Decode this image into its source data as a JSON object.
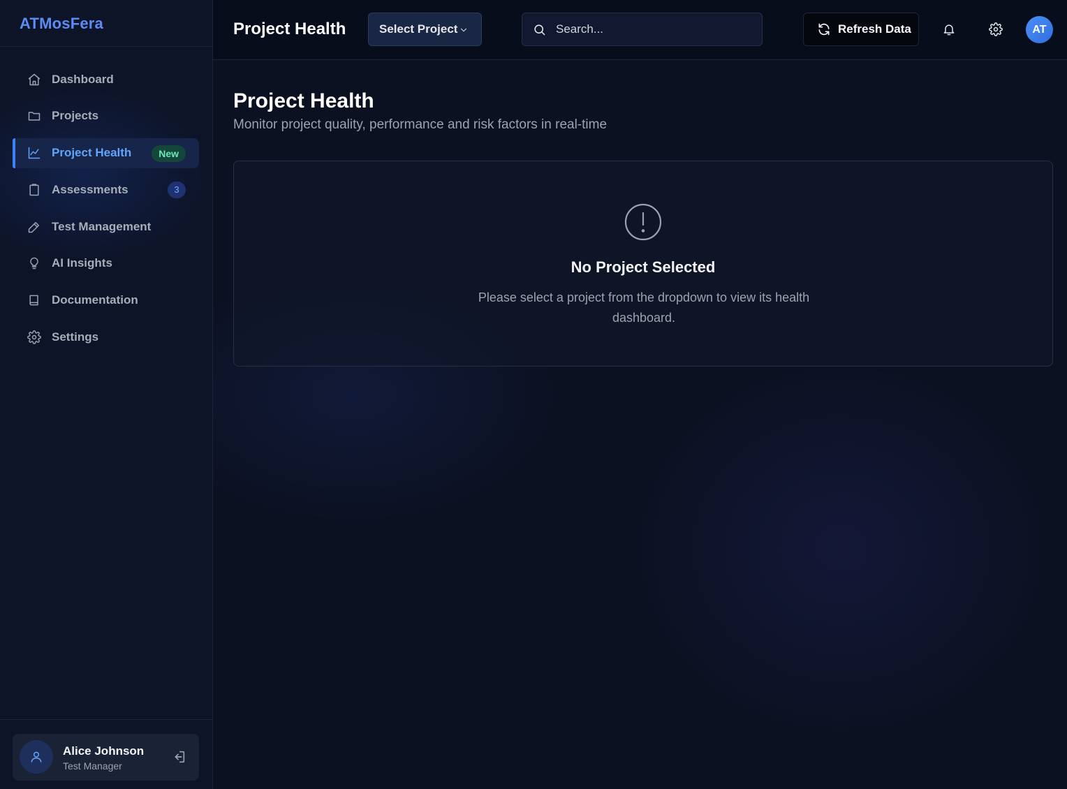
{
  "brand": {
    "name": "ATMosFera"
  },
  "sidebar": {
    "items": [
      {
        "label": "Dashboard",
        "icon": "home-icon"
      },
      {
        "label": "Projects",
        "icon": "folder-icon"
      },
      {
        "label": "Project Health",
        "icon": "chart-line-icon",
        "active": true,
        "badge": "New"
      },
      {
        "label": "Assessments",
        "icon": "clipboard-icon",
        "badge": "3"
      },
      {
        "label": "Test Management",
        "icon": "pencil-icon"
      },
      {
        "label": "AI Insights",
        "icon": "lightbulb-icon"
      },
      {
        "label": "Documentation",
        "icon": "book-icon"
      },
      {
        "label": "Settings",
        "icon": "gear-icon"
      }
    ],
    "user": {
      "name": "Alice Johnson",
      "role": "Test Manager"
    }
  },
  "header": {
    "title": "Project Health",
    "project_select": "Select Project",
    "search_placeholder": "Search...",
    "refresh_label": "Refresh Data",
    "avatar_initials": "AT"
  },
  "main": {
    "title": "Project Health",
    "subtitle": "Monitor project quality, performance and risk factors in real-time",
    "empty": {
      "title": "No Project Selected",
      "message": "Please select a project from the dropdown to view its health dashboard."
    }
  },
  "colors": {
    "accent": "#3b82f6",
    "brand": "#5b8cf5",
    "badge_new": "#6ee7b7",
    "background": "#0c1122"
  }
}
